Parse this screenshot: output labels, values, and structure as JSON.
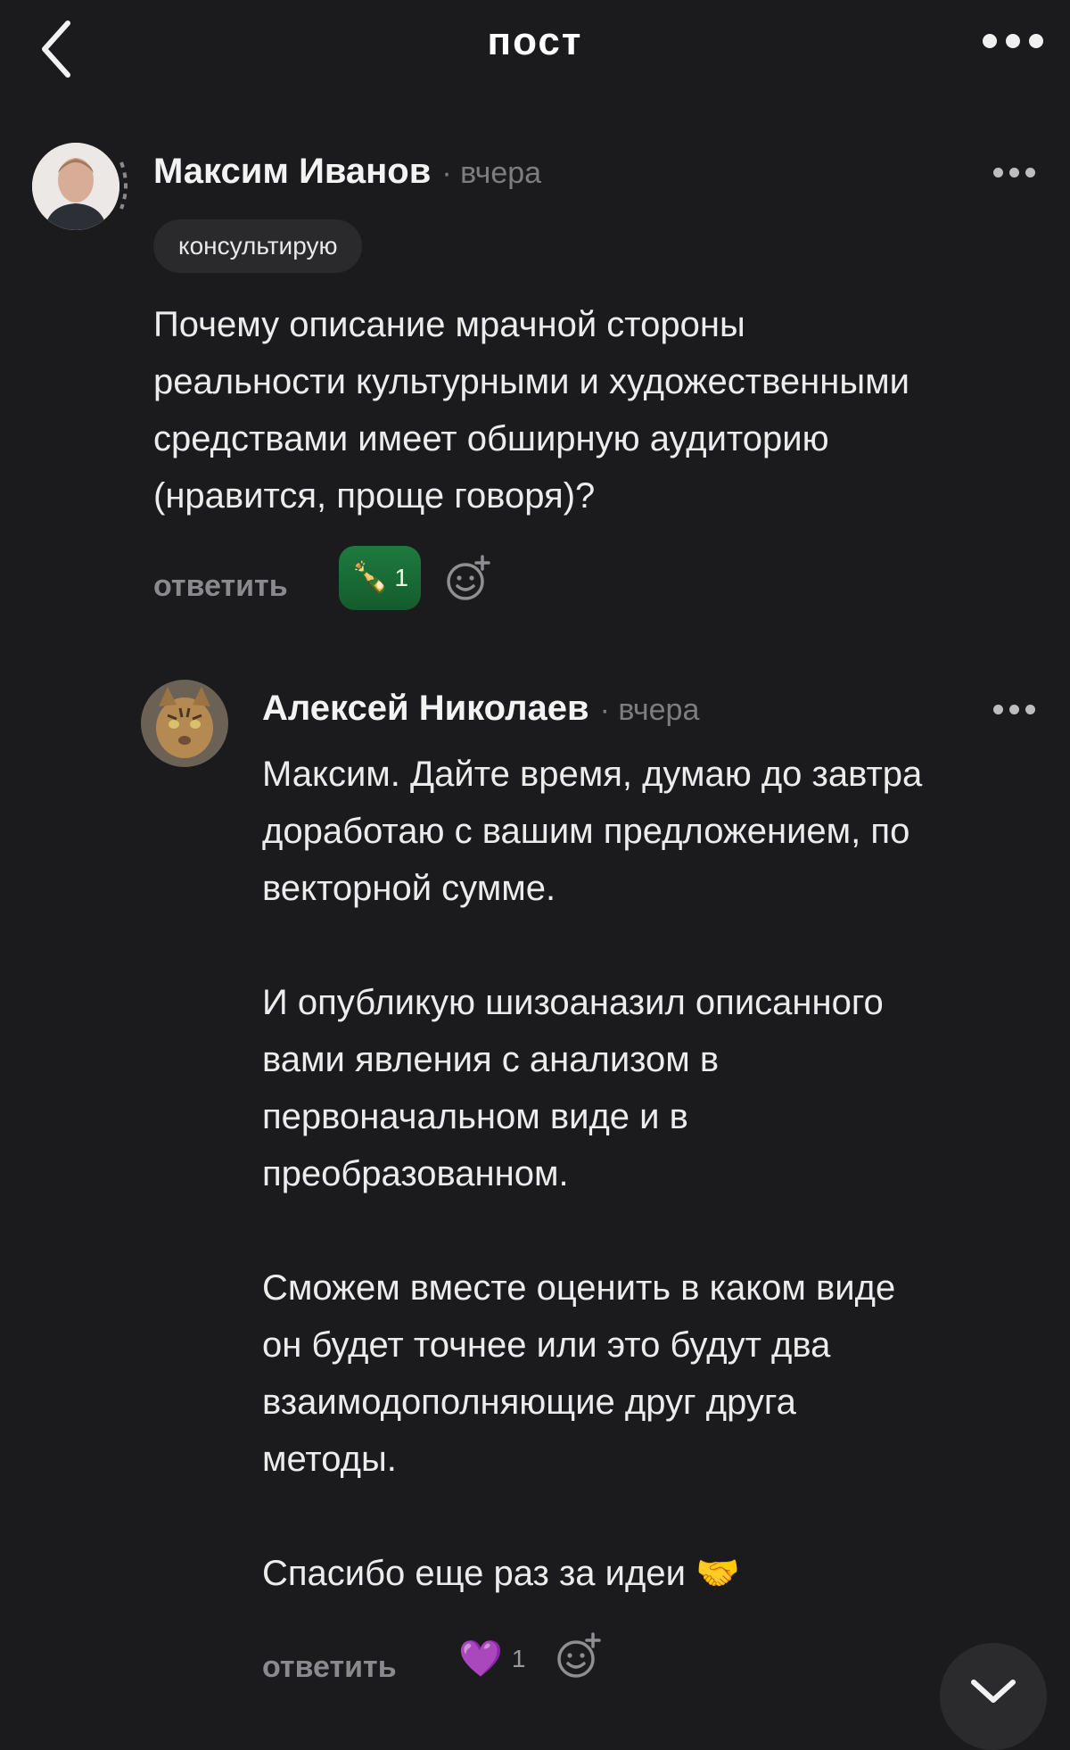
{
  "header": {
    "title": "пост"
  },
  "post": {
    "author": "Максим Иванов",
    "time": "· вчера",
    "badge": "консультирую",
    "text_lines": [
      "Почему описание мрачной стороны",
      "реальности культурными и художественными",
      "средствами имеет обширную аудиторию",
      "(нравится, проще говоря)?"
    ],
    "reply_label": "ответить",
    "reaction": {
      "emoji": "🍾",
      "count": "1",
      "color": "#1a6b36"
    }
  },
  "comment": {
    "author": "Алексей Николаев",
    "time": "· вчера",
    "paragraphs": [
      [
        "Максим. Дайте время, думаю до завтра",
        "доработаю с вашим предложением, по",
        "векторной сумме."
      ],
      [
        "И опубликую шизоаназил описанного",
        "вами явления с анализом в",
        "первоначальном виде и в",
        "преобразованном."
      ],
      [
        "Сможем вместе оценить в каком виде",
        "он будет точнее или это будут два",
        "взаимодополняющие друг друга",
        "методы."
      ],
      [
        "Спасибо еще раз за идеи 🤝"
      ]
    ],
    "reply_label": "ответить",
    "reaction": {
      "emoji": "💜",
      "count": "1"
    }
  },
  "icons": {
    "back": "chevron-left-icon",
    "more": "more-horizontal-icon",
    "add_reaction": "add-reaction-icon",
    "scroll_down": "chevron-down-icon"
  }
}
